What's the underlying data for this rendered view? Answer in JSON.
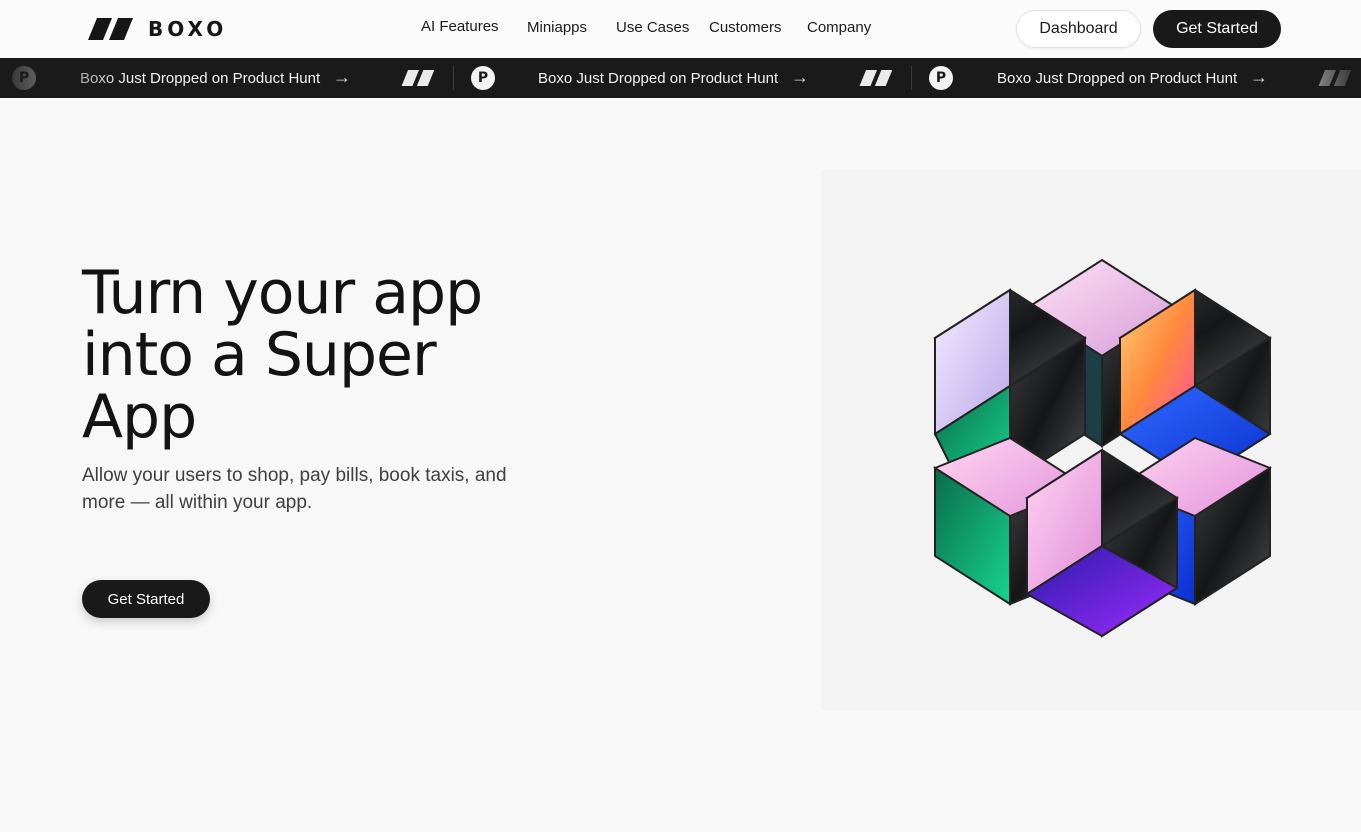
{
  "header": {
    "brand": "BOXO",
    "nav": [
      "AI Features",
      "Miniapps",
      "Use Cases",
      "Customers",
      "Company"
    ],
    "dashboard_label": "Dashboard",
    "get_started_label": "Get Started"
  },
  "ticker": {
    "announcement": "Boxo Just Dropped on Product Hunt",
    "product_hunt_letter": "P",
    "arrow": "→"
  },
  "hero": {
    "title": "Turn your app into a Super App",
    "subtitle": "Allow your users to shop, pay bills, book taxis, and more — all within your app.",
    "cta_label": "Get Started"
  },
  "icons": [
    "boxo-logo-icon",
    "product-hunt-icon",
    "arrow-right-icon"
  ]
}
